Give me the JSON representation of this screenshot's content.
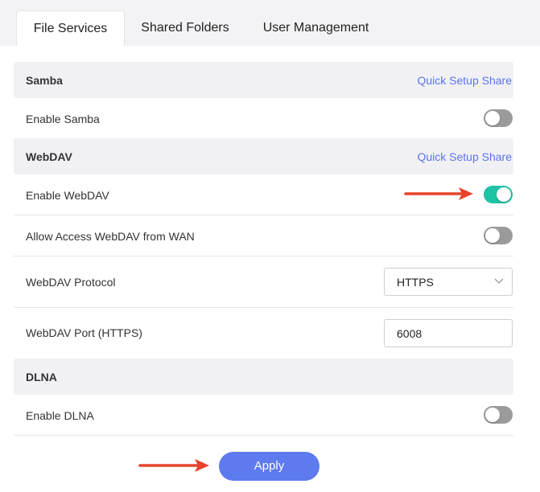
{
  "tabs": [
    {
      "label": "File Services",
      "active": true
    },
    {
      "label": "Shared Folders",
      "active": false
    },
    {
      "label": "User Management",
      "active": false
    }
  ],
  "samba": {
    "title": "Samba",
    "quick_setup": "Quick Setup Share",
    "enable_label": "Enable Samba",
    "enabled": false
  },
  "webdav": {
    "title": "WebDAV",
    "quick_setup": "Quick Setup Share",
    "enable_label": "Enable WebDAV",
    "enabled": true,
    "wan_label": "Allow Access WebDAV from WAN",
    "wan_enabled": false,
    "protocol_label": "WebDAV Protocol",
    "protocol_value": "HTTPS",
    "port_label": "WebDAV Port (HTTPS)",
    "port_value": "6008"
  },
  "dlna": {
    "title": "DLNA",
    "enable_label": "Enable DLNA",
    "enabled": false
  },
  "apply_label": "Apply",
  "colors": {
    "accent": "#5d7aef",
    "toggle_on": "#1fc2a4",
    "annotation_arrow": "#e8432c",
    "link": "#5b74e8"
  },
  "icons": {
    "dropdown": "chevron-down-icon",
    "annotation": "red-arrow-icon"
  }
}
